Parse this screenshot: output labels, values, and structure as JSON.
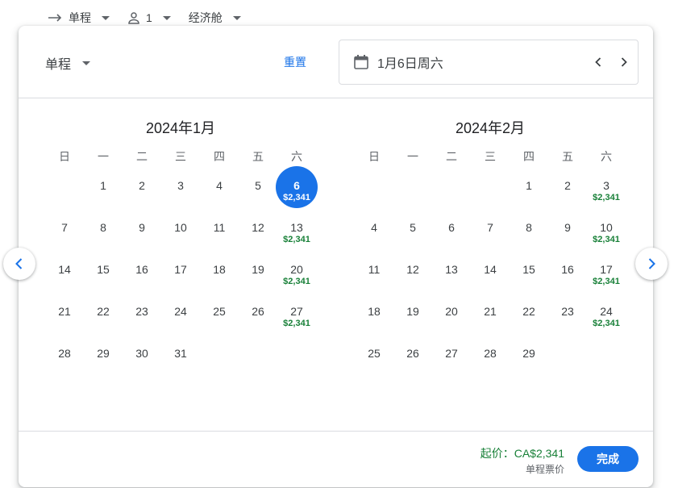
{
  "topbar": {
    "trip_type": "单程",
    "passengers": "1",
    "cabin": "经济舱"
  },
  "header": {
    "trip_type": "单程",
    "reset_label": "重置",
    "selected_date": "1月6日周六"
  },
  "weekdays": [
    "日",
    "一",
    "二",
    "三",
    "四",
    "五",
    "六"
  ],
  "months": [
    {
      "title": "2024年1月",
      "days": [
        {
          "num": "",
          "price": ""
        },
        {
          "num": "1",
          "price": ""
        },
        {
          "num": "2",
          "price": ""
        },
        {
          "num": "3",
          "price": ""
        },
        {
          "num": "4",
          "price": ""
        },
        {
          "num": "5",
          "price": ""
        },
        {
          "num": "6",
          "price": "$2,341",
          "selected": true
        },
        {
          "num": "7",
          "price": ""
        },
        {
          "num": "8",
          "price": ""
        },
        {
          "num": "9",
          "price": ""
        },
        {
          "num": "10",
          "price": ""
        },
        {
          "num": "11",
          "price": ""
        },
        {
          "num": "12",
          "price": ""
        },
        {
          "num": "13",
          "price": "$2,341"
        },
        {
          "num": "14",
          "price": ""
        },
        {
          "num": "15",
          "price": ""
        },
        {
          "num": "16",
          "price": ""
        },
        {
          "num": "17",
          "price": ""
        },
        {
          "num": "18",
          "price": ""
        },
        {
          "num": "19",
          "price": ""
        },
        {
          "num": "20",
          "price": "$2,341"
        },
        {
          "num": "21",
          "price": ""
        },
        {
          "num": "22",
          "price": ""
        },
        {
          "num": "23",
          "price": ""
        },
        {
          "num": "24",
          "price": ""
        },
        {
          "num": "25",
          "price": ""
        },
        {
          "num": "26",
          "price": ""
        },
        {
          "num": "27",
          "price": "$2,341"
        },
        {
          "num": "28",
          "price": ""
        },
        {
          "num": "29",
          "price": ""
        },
        {
          "num": "30",
          "price": ""
        },
        {
          "num": "31",
          "price": ""
        }
      ]
    },
    {
      "title": "2024年2月",
      "days": [
        {
          "num": "",
          "price": ""
        },
        {
          "num": "",
          "price": ""
        },
        {
          "num": "",
          "price": ""
        },
        {
          "num": "",
          "price": ""
        },
        {
          "num": "1",
          "price": ""
        },
        {
          "num": "2",
          "price": ""
        },
        {
          "num": "3",
          "price": "$2,341"
        },
        {
          "num": "4",
          "price": ""
        },
        {
          "num": "5",
          "price": ""
        },
        {
          "num": "6",
          "price": ""
        },
        {
          "num": "7",
          "price": ""
        },
        {
          "num": "8",
          "price": ""
        },
        {
          "num": "9",
          "price": ""
        },
        {
          "num": "10",
          "price": "$2,341"
        },
        {
          "num": "11",
          "price": ""
        },
        {
          "num": "12",
          "price": ""
        },
        {
          "num": "13",
          "price": ""
        },
        {
          "num": "14",
          "price": ""
        },
        {
          "num": "15",
          "price": ""
        },
        {
          "num": "16",
          "price": ""
        },
        {
          "num": "17",
          "price": "$2,341"
        },
        {
          "num": "18",
          "price": ""
        },
        {
          "num": "19",
          "price": ""
        },
        {
          "num": "20",
          "price": ""
        },
        {
          "num": "21",
          "price": ""
        },
        {
          "num": "22",
          "price": ""
        },
        {
          "num": "23",
          "price": ""
        },
        {
          "num": "24",
          "price": "$2,341"
        },
        {
          "num": "25",
          "price": ""
        },
        {
          "num": "26",
          "price": ""
        },
        {
          "num": "27",
          "price": ""
        },
        {
          "num": "28",
          "price": ""
        },
        {
          "num": "29",
          "price": ""
        }
      ]
    }
  ],
  "footer": {
    "from_price": "起价：CA$2,341",
    "price_note": "单程票价",
    "done_label": "完成"
  },
  "icons": {
    "trip_arrow": "arrow-right-icon",
    "passenger": "person-icon",
    "calendar": "calendar-icon",
    "prev": "chevron-left-icon",
    "next": "chevron-right-icon"
  },
  "colors": {
    "accent": "#1a73e8",
    "price_green": "#188038"
  }
}
